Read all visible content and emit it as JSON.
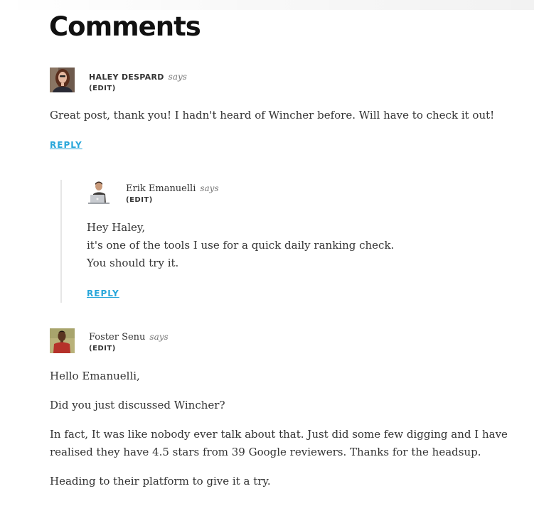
{
  "page": {
    "heading": "Comments"
  },
  "comments": [
    {
      "author": "HALEY DESPARD",
      "says": "says",
      "edit": "(EDIT)",
      "paragraphs": [
        "Great post, thank you! I hadn't heard of Wincher before. Will have to check it out!"
      ],
      "reply": "REPLY"
    },
    {
      "author": "Erik Emanuelli",
      "says": "says",
      "edit": "(EDIT)",
      "lines": [
        "Hey Haley,",
        "it's one of the tools I use for a quick daily ranking check.",
        "You should try it."
      ],
      "reply": "REPLY"
    },
    {
      "author": "Foster Senu",
      "says": "says",
      "edit": "(EDIT)",
      "paragraphs": [
        "Hello Emanuelli,",
        "Did you just discussed Wincher?",
        "In fact, It was like nobody ever talk about that. Just did some few digging and I have realised they have 4.5 stars from 39 Google reviewers. Thanks for the headsup.",
        "Heading to their platform to give it a try."
      ]
    }
  ],
  "colors": {
    "link": "#27a6da",
    "text": "#333333",
    "heading": "#111111",
    "thread_line": "#e6e6e6"
  },
  "icons": [
    "avatar-haley",
    "avatar-erik",
    "avatar-foster"
  ]
}
